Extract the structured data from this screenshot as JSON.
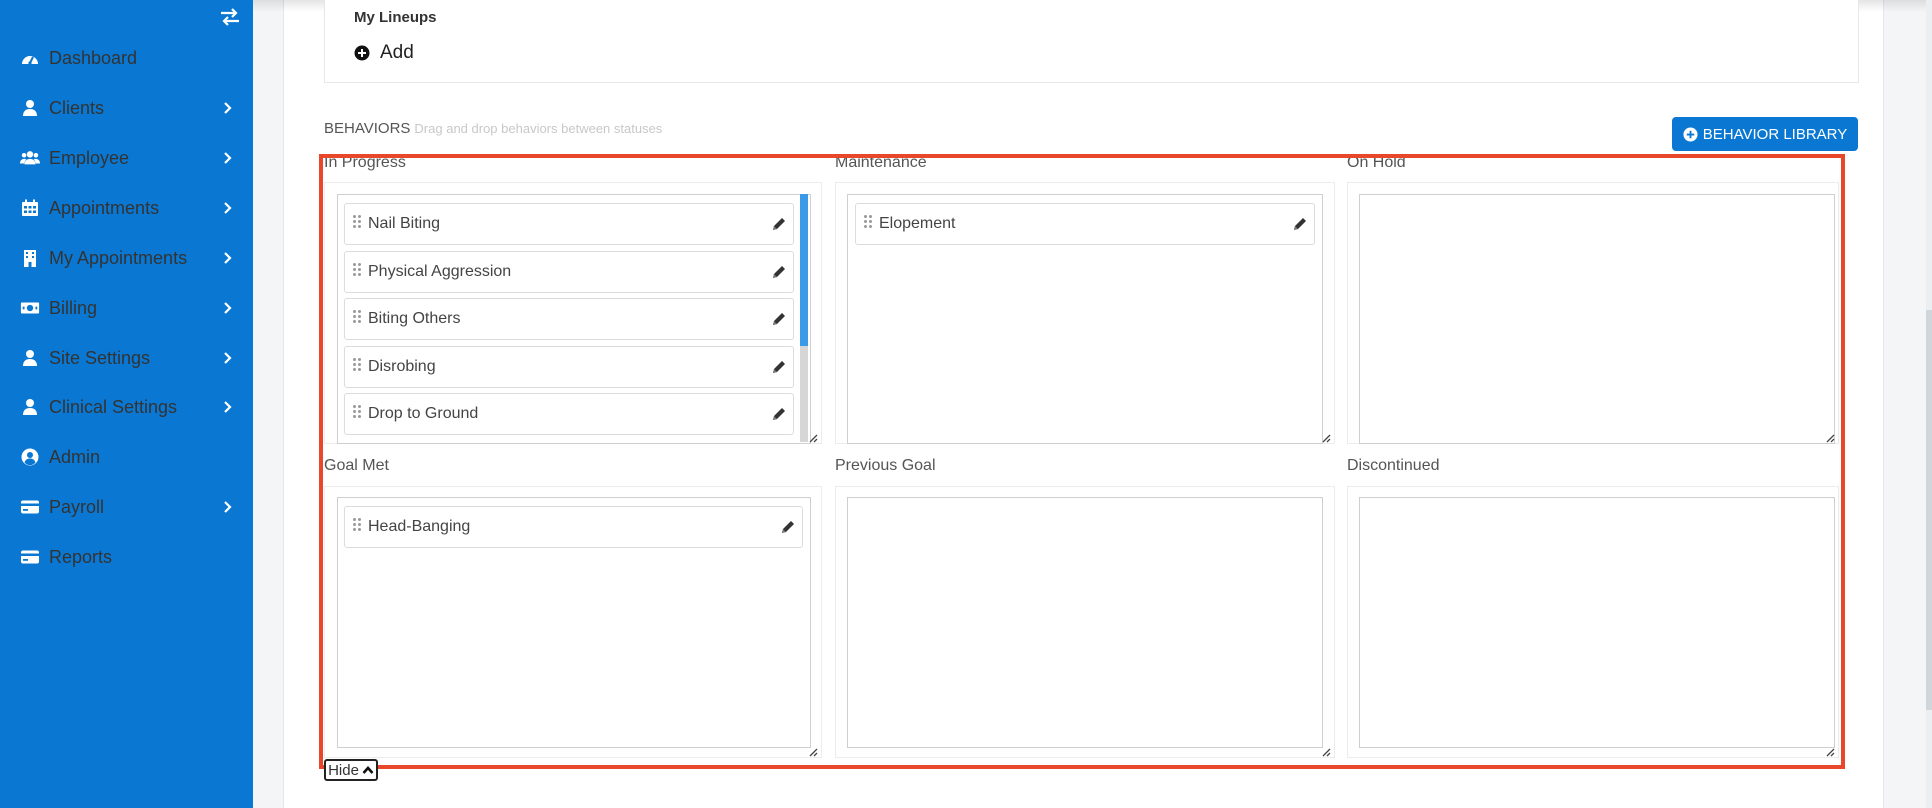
{
  "sidebar": {
    "items": [
      {
        "label": "Dashboard",
        "icon": "dashboard-icon",
        "has_submenu": false
      },
      {
        "label": "Clients",
        "icon": "user-icon",
        "has_submenu": true
      },
      {
        "label": "Employee",
        "icon": "users-icon",
        "has_submenu": true
      },
      {
        "label": "Appointments",
        "icon": "calendar-icon",
        "has_submenu": true
      },
      {
        "label": "My Appointments",
        "icon": "building-icon",
        "has_submenu": true
      },
      {
        "label": "Billing",
        "icon": "money-icon",
        "has_submenu": true
      },
      {
        "label": "Site Settings",
        "icon": "user-icon",
        "has_submenu": true
      },
      {
        "label": "Clinical Settings",
        "icon": "user-icon",
        "has_submenu": true
      },
      {
        "label": "Admin",
        "icon": "user-circle-icon",
        "has_submenu": false
      },
      {
        "label": "Payroll",
        "icon": "credit-card-icon",
        "has_submenu": true
      },
      {
        "label": "Reports",
        "icon": "credit-card-icon",
        "has_submenu": false
      }
    ]
  },
  "lineups": {
    "title": "My Lineups",
    "add_label": "Add"
  },
  "behaviors": {
    "title": "BEHAVIORS",
    "hint": "Drag and drop behaviors between statuses",
    "library_button": "BEHAVIOR LIBRARY",
    "hide_label": "Hide",
    "columns": [
      {
        "title": "In Progress",
        "items": [
          "Nail Biting",
          "Physical Aggression",
          "Biting Others",
          "Disrobing",
          "Drop to Ground"
        ]
      },
      {
        "title": "Maintenance",
        "items": [
          "Elopement"
        ]
      },
      {
        "title": "On Hold",
        "items": []
      },
      {
        "title": "Goal Met",
        "items": [
          "Head-Banging"
        ]
      },
      {
        "title": "Previous Goal",
        "items": []
      },
      {
        "title": "Discontinued",
        "items": []
      }
    ]
  },
  "colors": {
    "sidebar_bg": "#0a78d2",
    "highlight_border": "#e8472a",
    "scrollbar_thumb": "#3a9ae8"
  }
}
